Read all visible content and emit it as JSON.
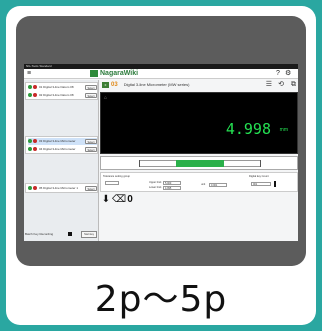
{
  "app": {
    "window_title": "NG-Tools Standard",
    "brand_name": "NagaraWiki"
  },
  "header": {
    "left_icon": "home-icon",
    "right_icons": [
      "help-icon",
      "gear-icon",
      "list-icon",
      "history-icon",
      "export-icon"
    ]
  },
  "device_list": {
    "group1": [
      {
        "label": "01  Digital 3-line Datum 08",
        "button": "Select",
        "selected": false
      },
      {
        "label": "02  Digital 3-line Datum 08",
        "button": "Select",
        "selected": false
      }
    ],
    "group2": [
      {
        "label": "03  Digital 3-line Micrometer",
        "button": "Select",
        "selected": true
      },
      {
        "label": "04  Digital 3-line Micrometer",
        "button": "Select",
        "selected": false
      }
    ],
    "group3": [
      {
        "label": "05  Digital 3-line Micrometer 1",
        "button": "Select",
        "selected": false
      }
    ],
    "bottom_label": "Batch Key Recording",
    "bottom_button": "Start key"
  },
  "main": {
    "device_number": "03",
    "device_title": "Digital 3-line Micrometer (MW series)",
    "reading": "4.998",
    "unit": "mm",
    "gauge_position": 0.5
  },
  "settings": {
    "section_label": "Tolerance setting group",
    "upper_label": "Upper limit",
    "lower_label": "Lower limit",
    "upper_value": "5.000",
    "lower_value": "4.995",
    "mid_label": "Judge",
    "unit_label": "unit",
    "unit_value": "0.001",
    "section2_label": "Digital key Count",
    "count_value": "001"
  },
  "tools": {
    "icons": [
      "download-icon",
      "eraser-icon",
      "zero-icon"
    ],
    "zero_glyph": "0"
  },
  "caption": "2p〜5p",
  "colors": {
    "background": "#2aa7a1",
    "panel": "#5c5c5c",
    "reading": "#24e052",
    "gauge_fill": "#2bb04a",
    "brand": "#2a7a3a"
  }
}
